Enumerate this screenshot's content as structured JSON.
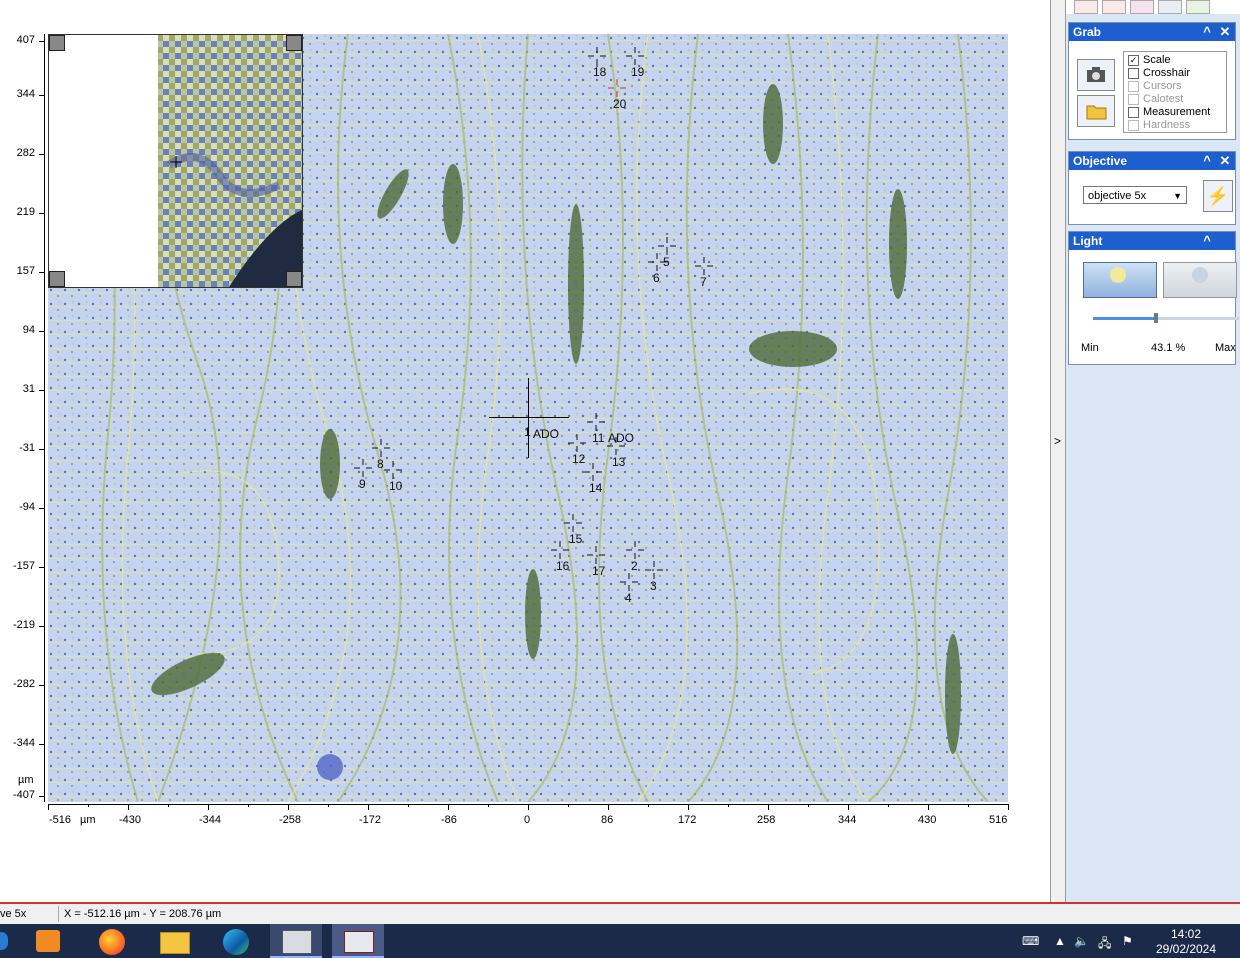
{
  "axes": {
    "y_ticks": [
      "407",
      "344",
      "282",
      "219",
      "157",
      "94",
      "31",
      "-31",
      "-94",
      "-157",
      "-219",
      "-282",
      "-344",
      "-407"
    ],
    "y_unit": "µm",
    "x_ticks": [
      "-516",
      "-430",
      "-344",
      "-258",
      "-172",
      "-86",
      "0",
      "86",
      "172",
      "258",
      "344",
      "430",
      "516"
    ],
    "x_unit": "µm"
  },
  "markers": [
    {
      "label": "18"
    },
    {
      "label": "19"
    },
    {
      "label": "20"
    },
    {
      "label": "5"
    },
    {
      "label": "6"
    },
    {
      "label": "7"
    },
    {
      "label": "1"
    },
    {
      "label": "ADO"
    },
    {
      "label": "11"
    },
    {
      "label": "ADO"
    },
    {
      "label": "12"
    },
    {
      "label": "13"
    },
    {
      "label": "14"
    },
    {
      "label": "8"
    },
    {
      "label": "9"
    },
    {
      "label": "10"
    },
    {
      "label": "15"
    },
    {
      "label": "16"
    },
    {
      "label": "17"
    },
    {
      "label": "2"
    },
    {
      "label": "3"
    },
    {
      "label": "4"
    }
  ],
  "panels": {
    "grab": {
      "title": "Grab",
      "options": [
        {
          "label": "Scale",
          "checked": true,
          "enabled": true
        },
        {
          "label": "Crosshair",
          "checked": false,
          "enabled": true
        },
        {
          "label": "Cursors",
          "checked": false,
          "enabled": false
        },
        {
          "label": "Calotest",
          "checked": false,
          "enabled": false
        },
        {
          "label": "Measurement",
          "checked": false,
          "enabled": true
        },
        {
          "label": "Hardness",
          "checked": false,
          "enabled": false
        }
      ]
    },
    "objective": {
      "title": "Objective",
      "selected": "objective 5x"
    },
    "light": {
      "title": "Light",
      "min_label": "Min",
      "value_label": "43.1 %",
      "max_label": "Max",
      "level": 0.431
    }
  },
  "status": {
    "objective_fragment": "ve 5x",
    "coords": "X = -512.16 µm - Y = 208.76 µm"
  },
  "taskbar": {
    "time": "14:02",
    "date": "29/02/2024"
  },
  "icons": {
    "toolbar": [
      "crosshair-tool-icon",
      "cursor-tool-icon",
      "target-tool-icon",
      "camera-tool-icon",
      "probe-tool-icon"
    ],
    "taskbar": [
      "media-player-icon",
      "firefox-icon",
      "file-explorer-icon",
      "edge-icon",
      "microscope-app-icon",
      "hardness-app-icon"
    ],
    "tray": [
      "keyboard-icon",
      "tray-chevron-icon",
      "volume-icon",
      "network-icon",
      "flag-icon"
    ]
  },
  "colors": {
    "header_blue": "#1e5fd0",
    "crosshair_red": "#d03020",
    "image_base": "#c9d6ee",
    "fiber": "#9fb86a"
  }
}
